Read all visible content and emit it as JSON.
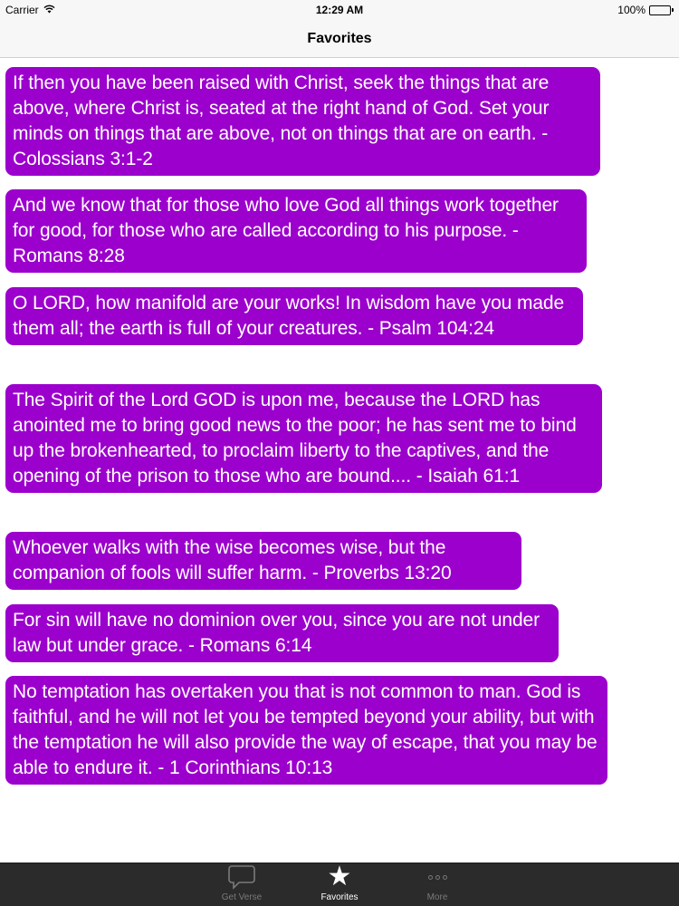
{
  "status_bar": {
    "carrier": "Carrier",
    "time": "12:29 AM",
    "battery": "100%",
    "icons": [
      "wifi-icon",
      "battery-icon"
    ]
  },
  "nav": {
    "title": "Favorites"
  },
  "verses": [
    {
      "text": "If then you have been raised with Christ, seek the things that are above, where Christ is, seated at the right hand of God. Set your minds on things that are above, not on things that are on earth. - Colossians 3:1-2"
    },
    {
      "text": "And we know that for those who love God all things work together for good, for those who are called according to his purpose. - Romans 8:28"
    },
    {
      "text": "O LORD, how manifold are your works! In wisdom have you made them all; the earth is full of your creatures. - Psalm 104:24"
    },
    {
      "text": "The Spirit of the Lord GOD is upon me, because the LORD has anointed me to bring good news to the poor; he has sent me to bind up the brokenhearted, to proclaim liberty to the captives, and the opening of the prison to those who are bound.... - Isaiah 61:1"
    },
    {
      "text": "Whoever walks with the wise becomes wise, but the companion of fools will suffer harm. - Proverbs 13:20"
    },
    {
      "text": "For sin will have no dominion over you, since you are not under law but under grace. - Romans 6:14"
    },
    {
      "text": "No temptation has overtaken you that is not common to man. God is faithful, and he will not let you be tempted beyond your ability, but with the temptation he will also provide the way of escape, that you may be able to endure it. - 1 Corinthians 10:13"
    }
  ],
  "tabs": [
    {
      "label": "Get Verse",
      "icon": "speech-bubble-icon",
      "active": false
    },
    {
      "label": "Favorites",
      "icon": "star-icon",
      "active": true
    },
    {
      "label": "More",
      "icon": "more-dots-icon",
      "active": false
    }
  ],
  "colors": {
    "bubble": "#9c00cc",
    "bubble_text": "#ffffff",
    "tab_bar": "#2b2b2b",
    "tab_active": "#ffffff",
    "tab_inactive": "#7a7a7a",
    "battery_fill": "#4cd964"
  }
}
